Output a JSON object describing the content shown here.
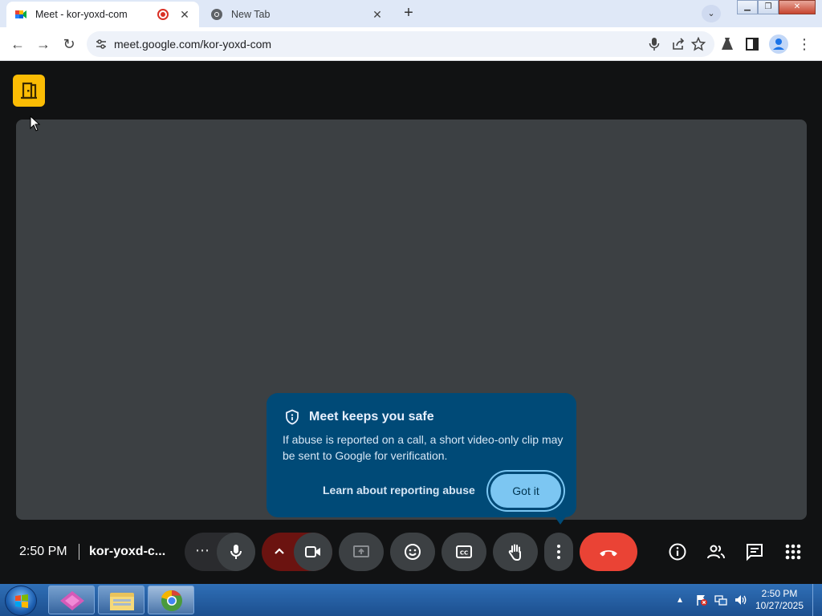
{
  "browser": {
    "tabs": [
      {
        "title": "Meet - kor-yoxd-com",
        "recording": true
      },
      {
        "title": "New Tab"
      }
    ],
    "url": "meet.google.com/kor-yoxd-com"
  },
  "meet": {
    "popover": {
      "title": "Meet keeps you safe",
      "body": "If abuse is reported on a call, a short video-only clip may be sent to Google for verification.",
      "learn_link": "Learn about reporting abuse",
      "got_it": "Got it"
    },
    "time": "2:50 PM",
    "meeting_name": "kor-yoxd-c...",
    "more_options_label": "⋯"
  },
  "taskbar": {
    "time": "2:50 PM",
    "date": "10/27/2025"
  },
  "colors": {
    "popover_bg": "#004a77",
    "end_call": "#ea4335",
    "stage_bg": "#3c4043",
    "door_button": "#fbbc04"
  }
}
